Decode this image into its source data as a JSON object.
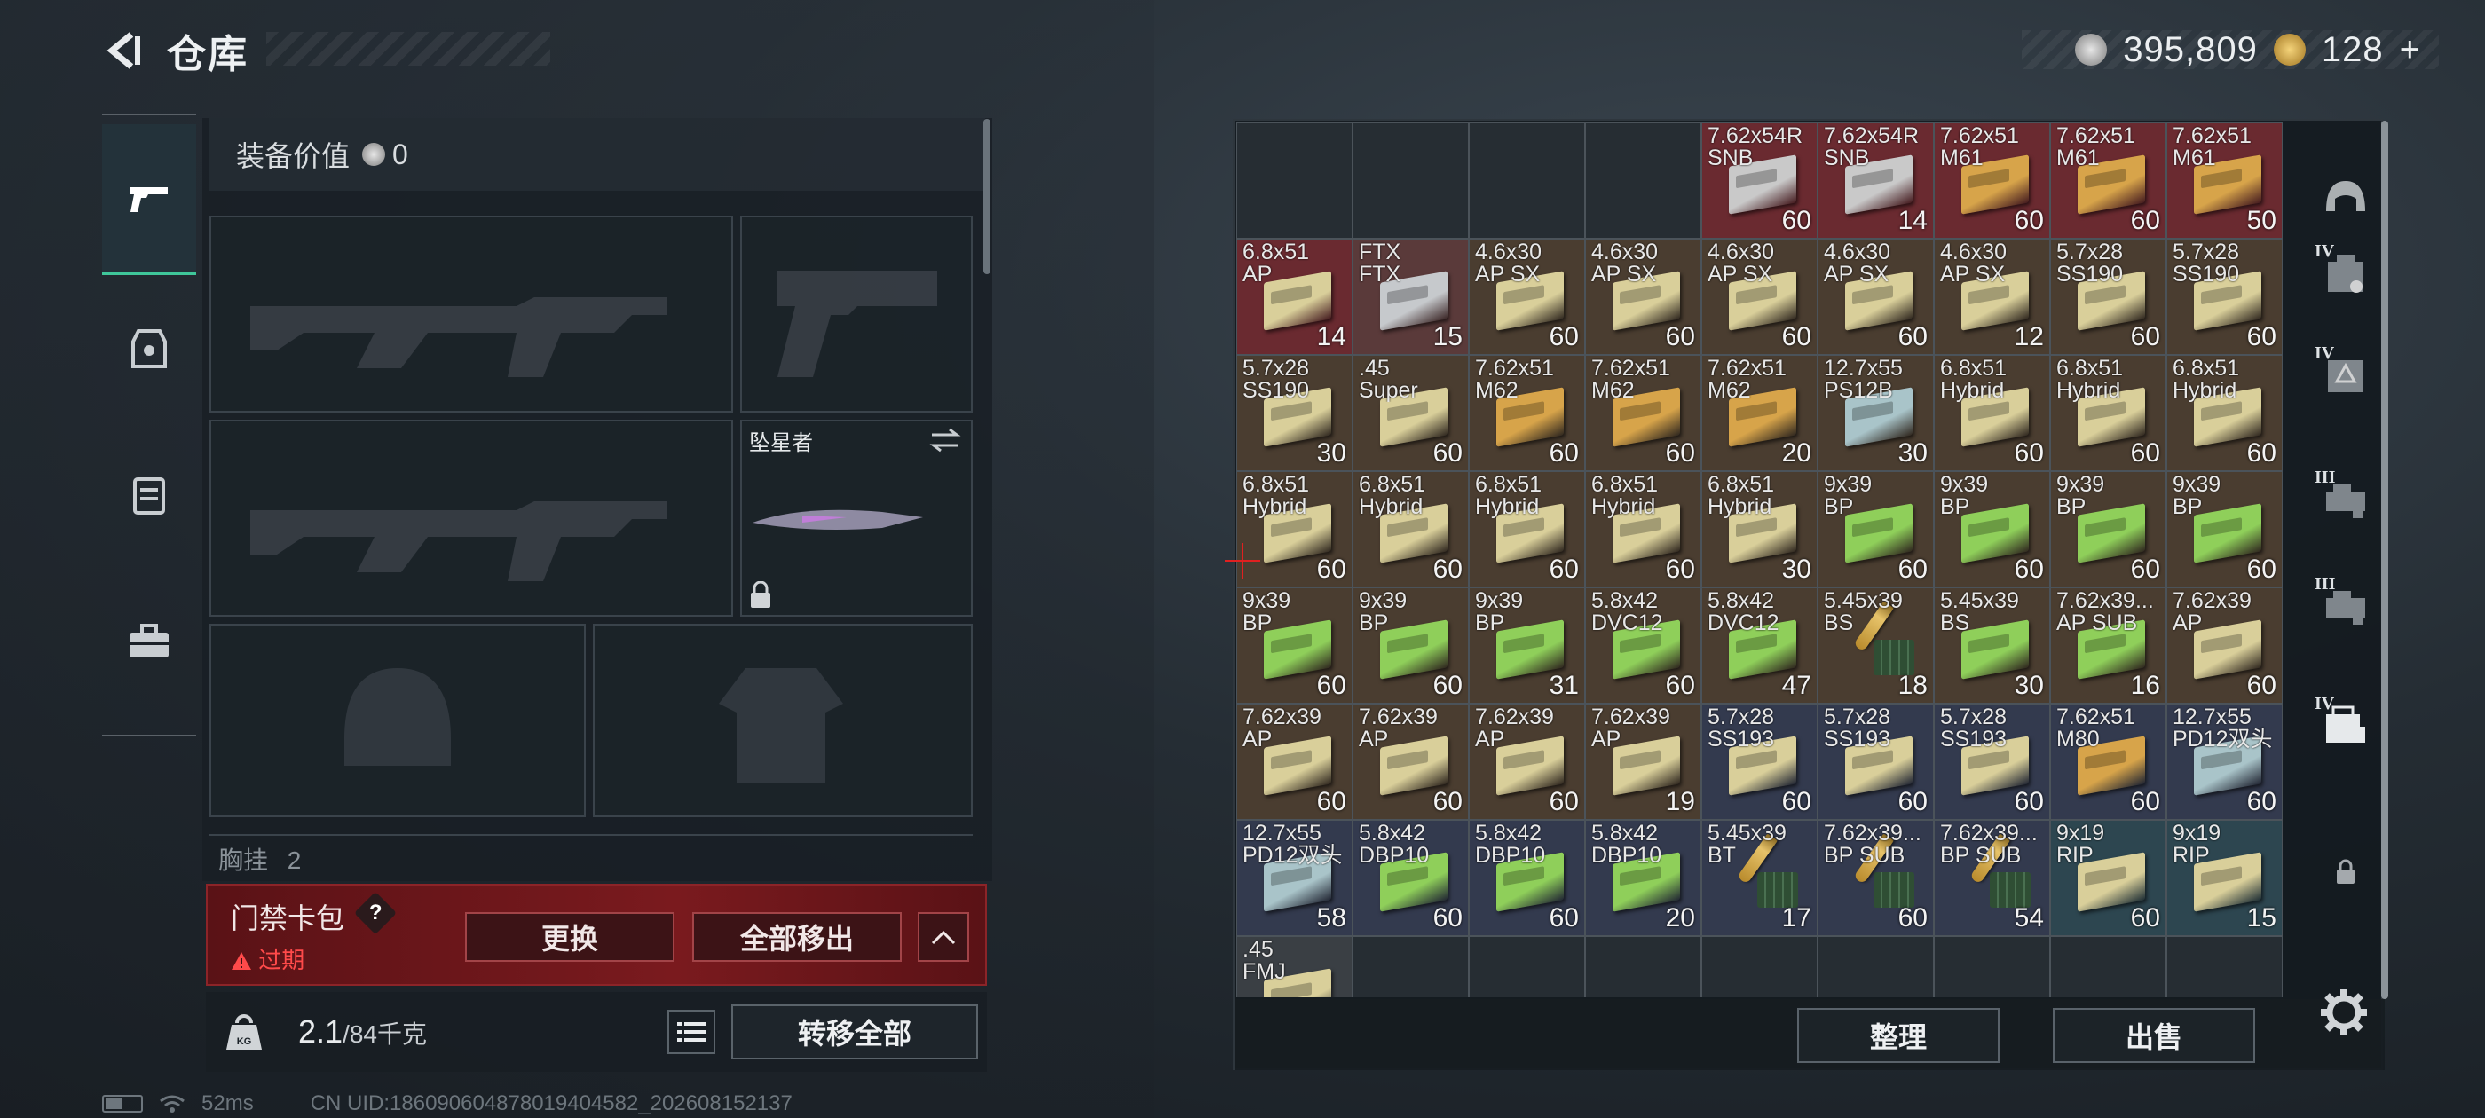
{
  "header": {
    "title": "仓库"
  },
  "currency": {
    "silver": "395,809",
    "gold": "128",
    "gold_plus": "+"
  },
  "loadout": {
    "value_label": "装备价值",
    "value": "0",
    "melee_label": "坠星者",
    "chest_label": "胸挂",
    "chest_count": "2"
  },
  "keycard": {
    "title": "门禁卡包",
    "help": "?",
    "expired": "过期",
    "replace_btn": "更换",
    "remove_all_btn": "全部移出"
  },
  "weight": {
    "current": "2.1",
    "max": "/84千克",
    "kg_icon": "KG"
  },
  "transfer_all_btn": "转移全部",
  "status": {
    "ping": "52ms",
    "uid": "CN UID:186090604878019404582_202608152137"
  },
  "inventory": {
    "sort_btn": "整理",
    "sell_btn": "出售",
    "cells": [
      {
        "name": "",
        "qty": "",
        "bg": "#262d33",
        "art": "none"
      },
      {
        "name": "",
        "qty": "",
        "bg": "#262d33",
        "art": "none"
      },
      {
        "name": "",
        "qty": "",
        "bg": "#262d33",
        "art": "none"
      },
      {
        "name": "",
        "qty": "",
        "bg": "#262d33",
        "art": "none"
      },
      {
        "name": "7.62x54R\nSNB",
        "qty": "60",
        "bg": "#6a2a30",
        "art": "#c9c9c9"
      },
      {
        "name": "7.62x54R\nSNB",
        "qty": "14",
        "bg": "#6a2a30",
        "art": "#c9c9c9"
      },
      {
        "name": "7.62x51\nM61",
        "qty": "60",
        "bg": "#6a2a30",
        "art": "#d7a44a"
      },
      {
        "name": "7.62x51\nM61",
        "qty": "60",
        "bg": "#6a2a30",
        "art": "#d7a44a"
      },
      {
        "name": "7.62x51\nM61",
        "qty": "50",
        "bg": "#6a2a30",
        "art": "#d7a44a"
      },
      {
        "name": "6.8x51\nAP",
        "qty": "14",
        "bg": "#6a2a30",
        "art": "#d9cf9a"
      },
      {
        "name": "FTX\nFTX",
        "qty": "15",
        "bg": "#5a3a3a",
        "art": "#c6c9cc"
      },
      {
        "name": "4.6x30\nAP SX",
        "qty": "60",
        "bg": "#4a3d30",
        "art": "#d9cf9a"
      },
      {
        "name": "4.6x30\nAP SX",
        "qty": "60",
        "bg": "#4a3d30",
        "art": "#d9cf9a"
      },
      {
        "name": "4.6x30\nAP SX",
        "qty": "60",
        "bg": "#4a3d30",
        "art": "#d9cf9a"
      },
      {
        "name": "4.6x30\nAP SX",
        "qty": "60",
        "bg": "#4a3d30",
        "art": "#d9cf9a"
      },
      {
        "name": "4.6x30\nAP SX",
        "qty": "12",
        "bg": "#4a3d30",
        "art": "#d9cf9a"
      },
      {
        "name": "5.7x28\nSS190",
        "qty": "60",
        "bg": "#4a3d30",
        "art": "#d9cf9a"
      },
      {
        "name": "5.7x28\nSS190",
        "qty": "60",
        "bg": "#4a3d30",
        "art": "#d9cf9a"
      },
      {
        "name": "5.7x28\nSS190",
        "qty": "30",
        "bg": "#4a3d30",
        "art": "#d9cf9a"
      },
      {
        "name": ".45\nSuper",
        "qty": "60",
        "bg": "#4a3d30",
        "art": "#d9cf9a"
      },
      {
        "name": "7.62x51\nM62",
        "qty": "60",
        "bg": "#4a3d30",
        "art": "#d7a44a"
      },
      {
        "name": "7.62x51\nM62",
        "qty": "60",
        "bg": "#4a3d30",
        "art": "#d7a44a"
      },
      {
        "name": "7.62x51\nM62",
        "qty": "20",
        "bg": "#4a3d30",
        "art": "#d7a44a"
      },
      {
        "name": "12.7x55\nPS12B",
        "qty": "30",
        "bg": "#4a3d30",
        "art": "#a9c4c9"
      },
      {
        "name": "6.8x51\nHybrid",
        "qty": "60",
        "bg": "#4a3d30",
        "art": "#d9cf9a"
      },
      {
        "name": "6.8x51\nHybrid",
        "qty": "60",
        "bg": "#4a3d30",
        "art": "#d9cf9a"
      },
      {
        "name": "6.8x51\nHybrid",
        "qty": "60",
        "bg": "#4a3d30",
        "art": "#d9cf9a"
      },
      {
        "name": "6.8x51\nHybrid",
        "qty": "60",
        "bg": "#4a3d30",
        "art": "#d9cf9a"
      },
      {
        "name": "6.8x51\nHybrid",
        "qty": "60",
        "bg": "#4a3d30",
        "art": "#d9cf9a"
      },
      {
        "name": "6.8x51\nHybrid",
        "qty": "60",
        "bg": "#4a3d30",
        "art": "#d9cf9a"
      },
      {
        "name": "6.8x51\nHybrid",
        "qty": "60",
        "bg": "#4a3d30",
        "art": "#d9cf9a"
      },
      {
        "name": "6.8x51\nHybrid",
        "qty": "30",
        "bg": "#4a3d30",
        "art": "#d9cf9a"
      },
      {
        "name": "9x39\nBP",
        "qty": "60",
        "bg": "#4a3d30",
        "art": "#8fcf5a"
      },
      {
        "name": "9x39\nBP",
        "qty": "60",
        "bg": "#4a3d30",
        "art": "#8fcf5a"
      },
      {
        "name": "9x39\nBP",
        "qty": "60",
        "bg": "#4a3d30",
        "art": "#8fcf5a"
      },
      {
        "name": "9x39\nBP",
        "qty": "60",
        "bg": "#4a3d30",
        "art": "#8fcf5a"
      },
      {
        "name": "9x39\nBP",
        "qty": "60",
        "bg": "#4a3d30",
        "art": "#8fcf5a"
      },
      {
        "name": "9x39\nBP",
        "qty": "60",
        "bg": "#4a3d30",
        "art": "#8fcf5a"
      },
      {
        "name": "9x39\nBP",
        "qty": "31",
        "bg": "#4a3d30",
        "art": "#8fcf5a"
      },
      {
        "name": "5.8x42\nDVC12",
        "qty": "60",
        "bg": "#4a3d30",
        "art": "#8fcf5a"
      },
      {
        "name": "5.8x42\nDVC12",
        "qty": "47",
        "bg": "#4a3d30",
        "art": "#8fcf5a"
      },
      {
        "name": "5.45x39\nBS",
        "qty": "18",
        "bg": "#4a3d30",
        "art": "bullet"
      },
      {
        "name": "5.45x39\nBS",
        "qty": "30",
        "bg": "#4a3d30",
        "art": "#8fcf5a"
      },
      {
        "name": "7.62x39...\nAP SUB",
        "qty": "16",
        "bg": "#4a3d30",
        "art": "#8fcf5a"
      },
      {
        "name": "7.62x39\nAP",
        "qty": "60",
        "bg": "#4a3d30",
        "art": "#d9cf9a"
      },
      {
        "name": "7.62x39\nAP",
        "qty": "60",
        "bg": "#4a3d30",
        "art": "#d9cf9a"
      },
      {
        "name": "7.62x39\nAP",
        "qty": "60",
        "bg": "#4a3d30",
        "art": "#d9cf9a"
      },
      {
        "name": "7.62x39\nAP",
        "qty": "60",
        "bg": "#4a3d30",
        "art": "#d9cf9a"
      },
      {
        "name": "7.62x39\nAP",
        "qty": "19",
        "bg": "#4a3d30",
        "art": "#d9cf9a"
      },
      {
        "name": "5.7x28\nSS193",
        "qty": "60",
        "bg": "#333a4e",
        "art": "#d9cf9a"
      },
      {
        "name": "5.7x28\nSS193",
        "qty": "60",
        "bg": "#333a4e",
        "art": "#d9cf9a"
      },
      {
        "name": "5.7x28\nSS193",
        "qty": "60",
        "bg": "#333a4e",
        "art": "#d9cf9a"
      },
      {
        "name": "7.62x51\nM80",
        "qty": "60",
        "bg": "#333a4e",
        "art": "#d7a44a"
      },
      {
        "name": "12.7x55\nPD12双头",
        "qty": "60",
        "bg": "#333a4e",
        "art": "#a9c4c9"
      },
      {
        "name": "12.7x55\nPD12双头",
        "qty": "58",
        "bg": "#333a4e",
        "art": "#a9c4c9"
      },
      {
        "name": "5.8x42\nDBP10",
        "qty": "60",
        "bg": "#333a4e",
        "art": "#8fcf5a"
      },
      {
        "name": "5.8x42\nDBP10",
        "qty": "60",
        "bg": "#333a4e",
        "art": "#8fcf5a"
      },
      {
        "name": "5.8x42\nDBP10",
        "qty": "20",
        "bg": "#333a4e",
        "art": "#8fcf5a"
      },
      {
        "name": "5.45x39\nBT",
        "qty": "17",
        "bg": "#333a4e",
        "art": "bullet"
      },
      {
        "name": "7.62x39...\nBP SUB",
        "qty": "60",
        "bg": "#333a4e",
        "art": "bullet"
      },
      {
        "name": "7.62x39...\nBP SUB",
        "qty": "54",
        "bg": "#333a4e",
        "art": "bullet"
      },
      {
        "name": "9x19\nRIP",
        "qty": "60",
        "bg": "#2d4650",
        "art": "#d9cf9a"
      },
      {
        "name": "9x19\nRIP",
        "qty": "15",
        "bg": "#2d4650",
        "art": "#d9cf9a"
      },
      {
        "name": ".45\nFMJ",
        "qty": "",
        "bg": "#3a3f44",
        "art": "#d9cf9a"
      },
      {
        "name": "",
        "qty": "",
        "bg": "#262d33",
        "art": "none"
      },
      {
        "name": "",
        "qty": "",
        "bg": "#262d33",
        "art": "none"
      },
      {
        "name": "",
        "qty": "",
        "bg": "#262d33",
        "art": "none"
      },
      {
        "name": "",
        "qty": "",
        "bg": "#262d33",
        "art": "none"
      },
      {
        "name": "",
        "qty": "",
        "bg": "#262d33",
        "art": "none"
      },
      {
        "name": "",
        "qty": "",
        "bg": "#262d33",
        "art": "none"
      },
      {
        "name": "",
        "qty": "",
        "bg": "#262d33",
        "art": "none"
      },
      {
        "name": "",
        "qty": "",
        "bg": "#262d33",
        "art": "none"
      }
    ]
  },
  "right_tabs": [
    {
      "icon": "helmet-icon",
      "tier": ""
    },
    {
      "icon": "armor-icon",
      "tier": "IV"
    },
    {
      "icon": "rig-icon",
      "tier": "IV"
    },
    {
      "icon": "backpack-icon",
      "tier": "III"
    },
    {
      "icon": "backpack-icon",
      "tier": "III"
    },
    {
      "icon": "case-icon",
      "tier": "IV"
    },
    {
      "icon": "lock-icon",
      "tier": ""
    }
  ],
  "colors": {
    "accent": "#3fc79a",
    "danger": "#ff4a4a",
    "keycard_bg": "#7a1a1e"
  }
}
